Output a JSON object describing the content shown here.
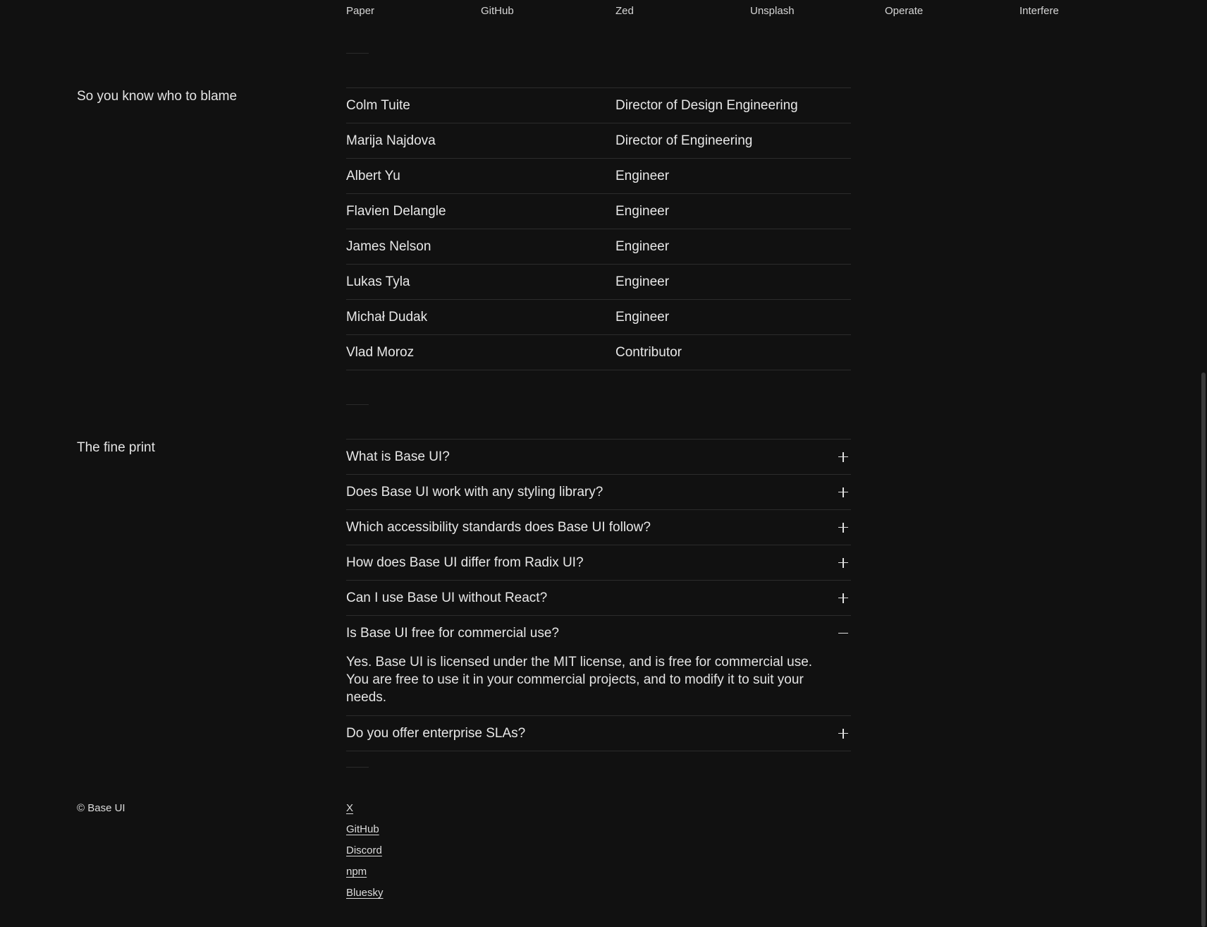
{
  "logos": [
    "Paper",
    "GitHub",
    "Zed",
    "Unsplash",
    "Operate",
    "Interfere"
  ],
  "team": {
    "label": "So you know who to blame",
    "members": [
      {
        "name": "Colm Tuite",
        "role": "Director of Design Engineering"
      },
      {
        "name": "Marija Najdova",
        "role": "Director of Engineering"
      },
      {
        "name": "Albert Yu",
        "role": "Engineer"
      },
      {
        "name": "Flavien Delangle",
        "role": "Engineer"
      },
      {
        "name": "James Nelson",
        "role": "Engineer"
      },
      {
        "name": "Lukas Tyla",
        "role": "Engineer"
      },
      {
        "name": "Michał Dudak",
        "role": "Engineer"
      },
      {
        "name": "Vlad Moroz",
        "role": "Contributor"
      }
    ]
  },
  "faq": {
    "label": "The fine print",
    "items": [
      {
        "q": "What is Base UI?",
        "open": false
      },
      {
        "q": "Does Base UI work with any styling library?",
        "open": false
      },
      {
        "q": "Which accessibility standards does Base UI follow?",
        "open": false
      },
      {
        "q": "How does Base UI differ from Radix UI?",
        "open": false
      },
      {
        "q": "Can I use Base UI without React?",
        "open": false
      },
      {
        "q": "Is Base UI free for commercial use?",
        "open": true,
        "a": "Yes. Base UI is licensed under the MIT license, and is free for commercial use. You are free to use it in your commercial projects, and to modify it to suit your needs."
      },
      {
        "q": "Do you offer enterprise SLAs?",
        "open": false
      }
    ]
  },
  "footer": {
    "copyright": "© Base UI",
    "links": [
      "X",
      "GitHub",
      "Discord",
      "npm",
      "Bluesky"
    ]
  },
  "colors": {
    "background": "#111111",
    "text": "#e8e8e8",
    "divider": "#2c2c2c"
  }
}
